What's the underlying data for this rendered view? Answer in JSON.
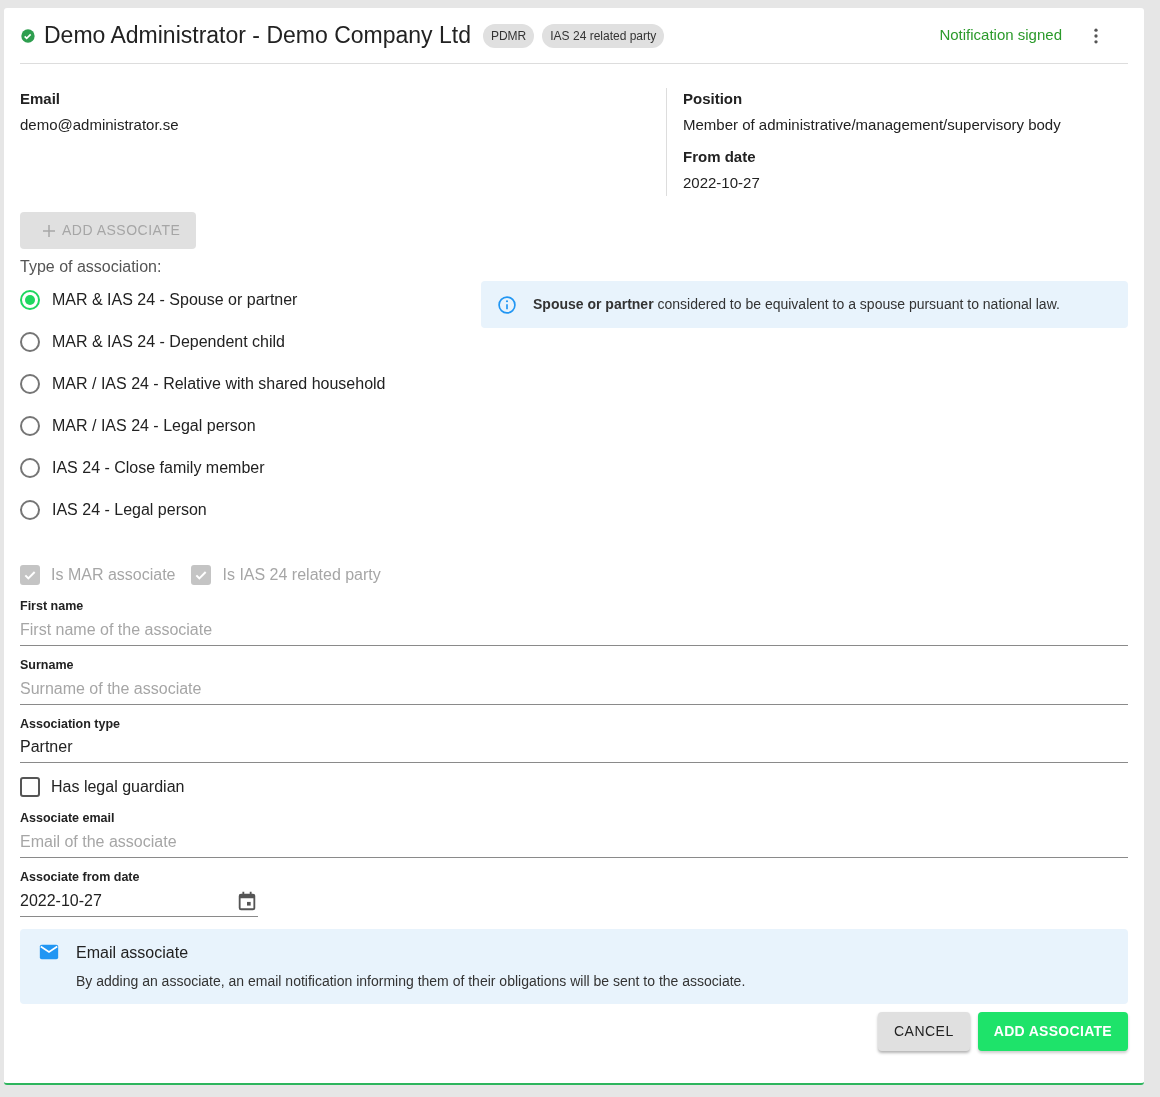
{
  "header": {
    "title": "Demo Administrator - Demo Company Ltd",
    "verified": true,
    "tags": [
      "PDMR",
      "IAS 24 related party"
    ],
    "status": "Notification signed"
  },
  "details": {
    "left": [
      {
        "label": "Email",
        "value": "demo@administrator.se"
      }
    ],
    "right": [
      {
        "label": "Position",
        "value": "Member of administrative/management/supervisory body"
      },
      {
        "label": "From date",
        "value": "2022-10-27"
      }
    ]
  },
  "add_associate_button": {
    "label": "ADD ASSOCIATE",
    "disabled": true
  },
  "association": {
    "label": "Type of association:",
    "options": [
      {
        "label": "MAR & IAS 24 - Spouse or partner",
        "selected": true
      },
      {
        "label": "MAR & IAS 24 - Dependent child",
        "selected": false
      },
      {
        "label": "MAR / IAS 24 - Relative with shared household",
        "selected": false
      },
      {
        "label": "MAR / IAS 24 - Legal person",
        "selected": false
      },
      {
        "label": "IAS 24 - Close family member",
        "selected": false
      },
      {
        "label": "IAS 24 - Legal person",
        "selected": false
      }
    ],
    "info": "**Spouse or partner** considered to be equivalent to a spouse pursuant to national law."
  },
  "flags": [
    {
      "label": "Is MAR associate",
      "checked": true,
      "disabled": true
    },
    {
      "label": "Is IAS 24 related party",
      "checked": true,
      "disabled": true
    }
  ],
  "fields": [
    {
      "kind": "text",
      "label": "First name",
      "placeholder": "First name of the associate"
    },
    {
      "kind": "text",
      "label": "Surname",
      "placeholder": "Surname of the associate"
    },
    {
      "kind": "text",
      "label": "Association type",
      "value": "Partner"
    },
    {
      "kind": "checkbox",
      "label": "Has legal guardian",
      "checked": false
    },
    {
      "kind": "text",
      "label": "Associate email",
      "placeholder": "Email of the associate"
    },
    {
      "kind": "date",
      "label": "Associate from date",
      "value": "2022-10-27"
    }
  ],
  "notice": {
    "title": "Email associate",
    "text": "By adding an associate, an email notification informing them of their obligations will be sent to the associate."
  },
  "buttons": [
    {
      "label": "CANCEL",
      "kind": "secondary"
    },
    {
      "label": "ADD ASSOCIATE",
      "kind": "primary"
    }
  ]
}
